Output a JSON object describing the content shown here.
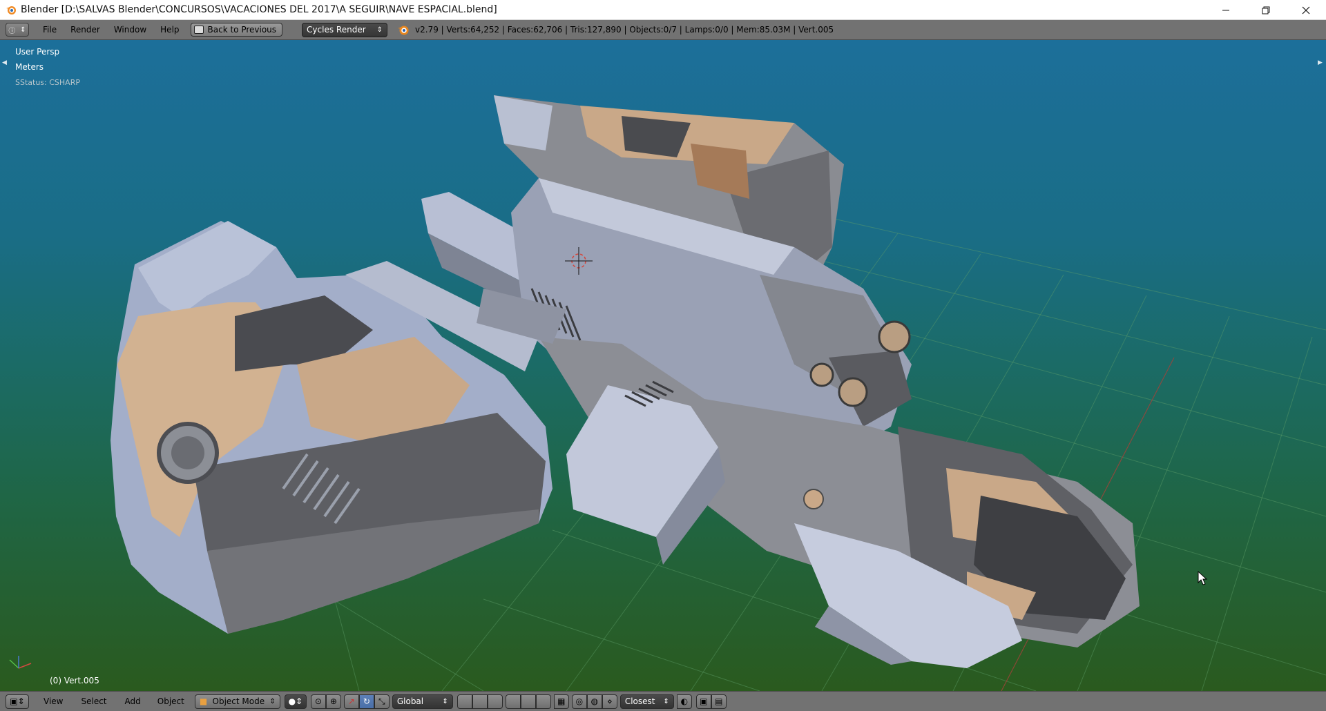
{
  "window": {
    "title": "Blender [D:\\SALVAS Blender\\CONCURSOS\\VACACIONES DEL 2017\\A SEGUIR\\NAVE ESPACIAL.blend]",
    "controls": [
      "minimize-icon",
      "restore-icon",
      "close-icon"
    ]
  },
  "info_header": {
    "menus": [
      "File",
      "Render",
      "Window",
      "Help"
    ],
    "back_button": "Back to Previous",
    "render_engine": "Cycles Render",
    "stats": "v2.79 | Verts:64,252 | Faces:62,706 | Tris:127,890 | Objects:0/7 | Lamps:0/0 | Mem:85.03M | Vert.005"
  },
  "viewport": {
    "view_name": "User Persp",
    "units": "Meters",
    "status": "SStatus: CSHARP",
    "active_object": "(0) Vert.005"
  },
  "footer": {
    "menus": [
      "View",
      "Select",
      "Add",
      "Object"
    ],
    "mode": "Object Mode",
    "orientation": "Global",
    "snap_target": "Closest"
  },
  "colors": {
    "header_bg": "#727272",
    "viewport_top": "#1c6f9a",
    "viewport_bottom": "#2a5a1e",
    "hull_light": "#a9b4cc",
    "hull_dark": "#5d5e62",
    "hull_tan": "#c9a888"
  }
}
